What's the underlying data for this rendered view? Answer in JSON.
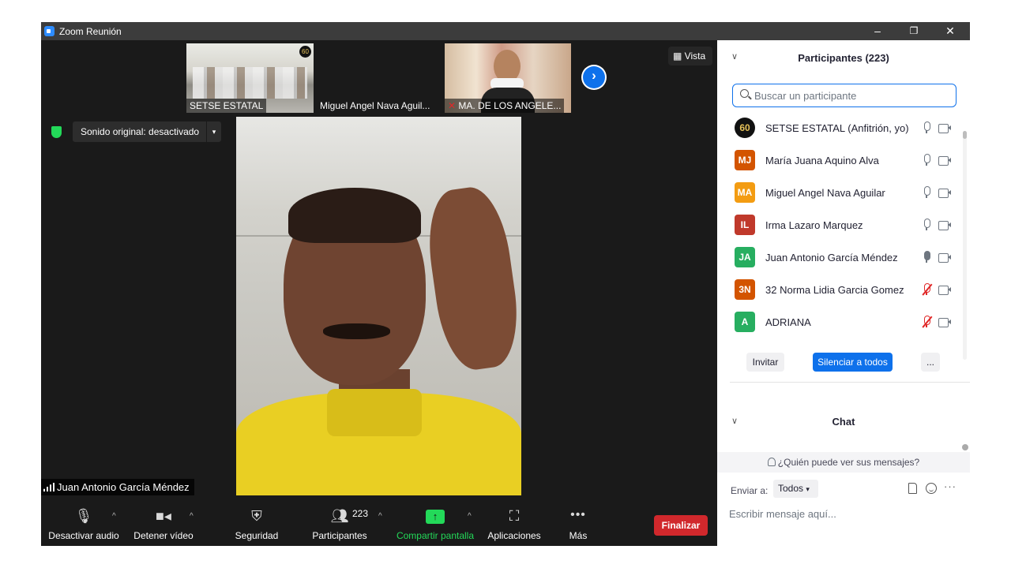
{
  "window": {
    "title": "Zoom Reunión",
    "min": "–",
    "restore": "❐",
    "close": "✕"
  },
  "thumbnails": [
    {
      "label": "SETSE ESTATAL",
      "badge": "60"
    },
    {
      "label": "Miguel Angel Nava Aguil..."
    },
    {
      "label": "MA. DE LOS ANGELE...",
      "muted": true
    }
  ],
  "view_button": "Vista",
  "sound_original": "Sonido original: desactivado",
  "active_speaker": "Juan Antonio García Méndez",
  "toolbar": {
    "mute_audio": "Desactivar audio",
    "stop_video": "Detener vídeo",
    "security": "Seguridad",
    "participants": "Participantes",
    "participants_count": "223",
    "share_screen": "Compartir pantalla",
    "apps": "Aplicaciones",
    "more": "Más",
    "end": "Finalizar"
  },
  "panel": {
    "title": "Participantes (223)",
    "search_placeholder": "Buscar un participante",
    "participants": [
      {
        "initials": "60",
        "name": "SETSE ESTATAL (Anfitrión, yo)",
        "color": "#111111",
        "mic": "on"
      },
      {
        "initials": "MJ",
        "name": "María Juana Aquino Alva",
        "color": "#d35400",
        "mic": "on"
      },
      {
        "initials": "MA",
        "name": "Miguel Angel Nava Aguilar",
        "color": "#f39c12",
        "mic": "on"
      },
      {
        "initials": "IL",
        "name": "Irma Lazaro Marquez",
        "color": "#c0392b",
        "mic": "on"
      },
      {
        "initials": "JA",
        "name": "Juan Antonio García Méndez",
        "color": "#27ae60",
        "mic": "active"
      },
      {
        "initials": "3N",
        "name": "32 Norma Lidia Garcia Gomez",
        "color": "#d35400",
        "mic": "muted"
      },
      {
        "initials": "A",
        "name": "ADRIANA",
        "color": "#27ae60",
        "mic": "muted"
      }
    ],
    "invite": "Invitar",
    "mute_all": "Silenciar a todos",
    "more": "...",
    "chat_title": "Chat",
    "who_can_see": "¿Quién puede ver sus mensajes?",
    "send_to_label": "Enviar a:",
    "send_to_value": "Todos",
    "chat_placeholder": "Escribir mensaje aquí...",
    "chat_more": "···"
  },
  "colors": {
    "accent": "#0e71eb",
    "end_red": "#d1282c",
    "share_green": "#23d959"
  }
}
